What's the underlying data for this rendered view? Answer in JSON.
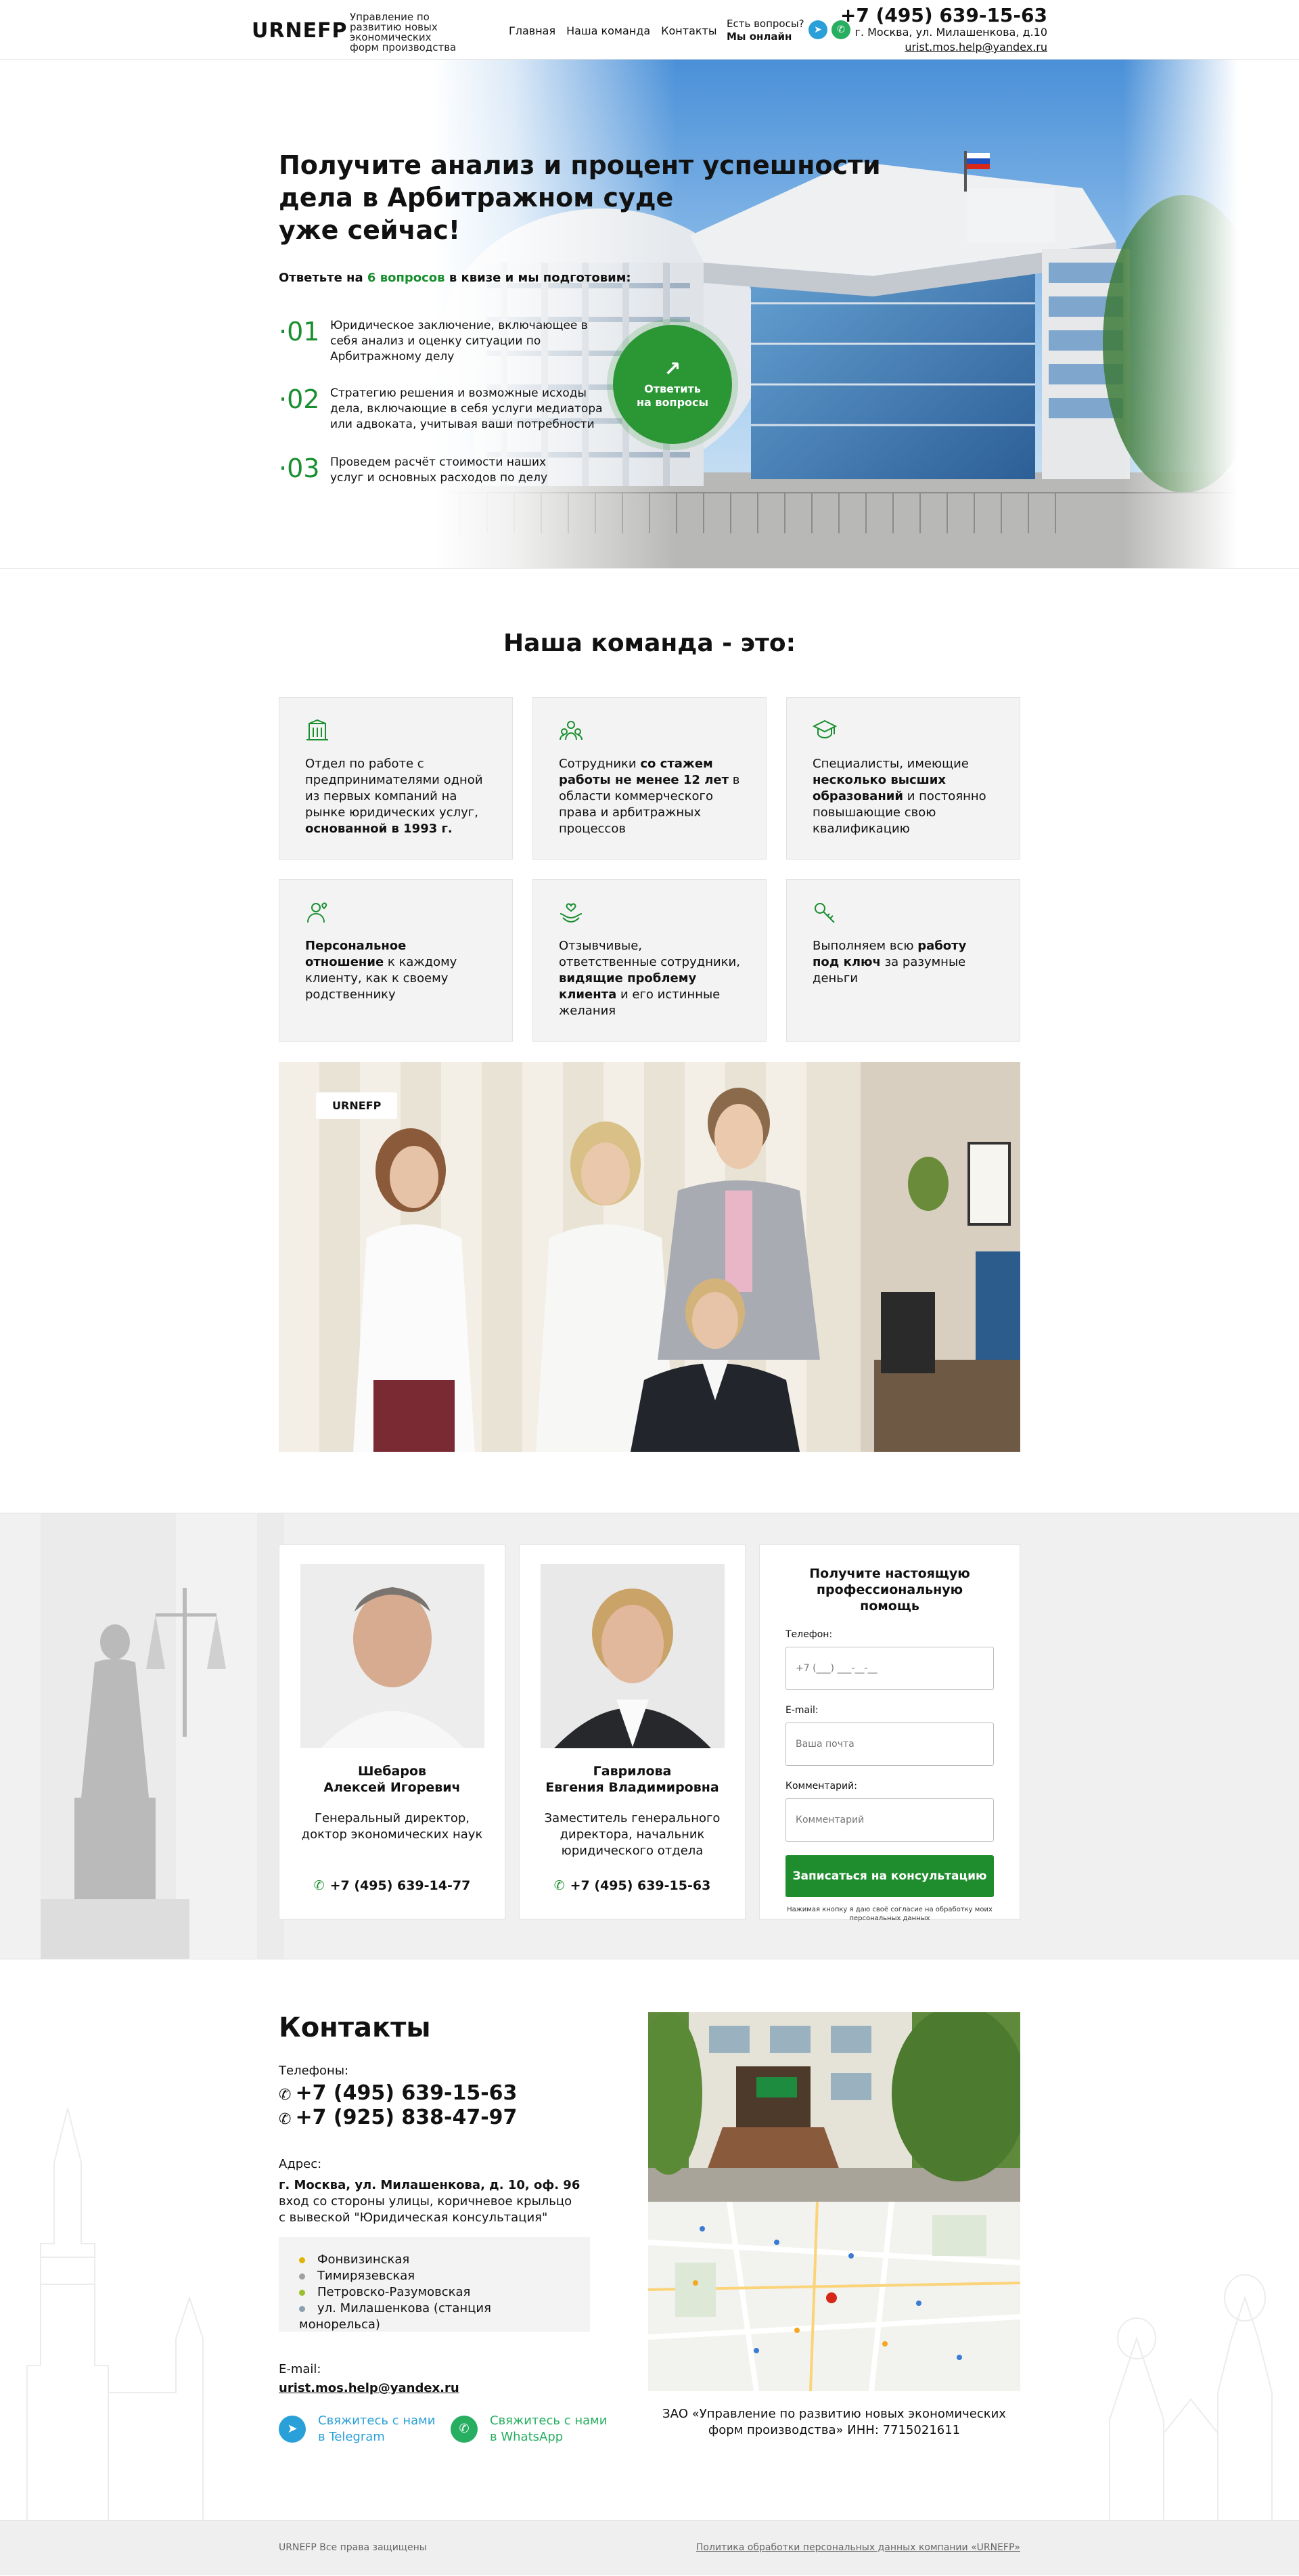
{
  "header": {
    "logo": "URNEFP",
    "logo_sub": "Управление по развитию новых экономических форм производства",
    "nav": [
      "Главная",
      "Наша команда",
      "Контакты"
    ],
    "question": "Есть вопросы?",
    "online": "Мы онлайн",
    "phone": "+7 (495) 639-15-63",
    "address": "г. Москва, ул. Милашенкова, д.10",
    "email": "urist.mos.help@yandex.ru"
  },
  "hero": {
    "title_line1": "Получите анализ и процент успешности",
    "title_line2": "дела в Арбитражном суде",
    "title_line3": "уже сейчас!",
    "sub_pre": "Ответьте на ",
    "sub_highlight": "6 вопросов",
    "sub_post": " в квизе и мы подготовим:",
    "steps": [
      {
        "num": "01",
        "text": "Юридическое заключение, включающее в себя анализ и оценку ситуации по Арбитражному делу"
      },
      {
        "num": "02",
        "text": "Стратегию решения и возможные исходы дела, включающие в себя услуги медиатора или адвоката, учитывая ваши потребности"
      },
      {
        "num": "03",
        "text": "Проведем расчёт стоимости наших услуг и основных расходов по делу"
      }
    ],
    "cta": "Ответить на вопросы"
  },
  "team": {
    "title": "Наша команда - это:",
    "cards": [
      {
        "icon": "building-icon",
        "a": "Отдел по работе с предпринимателями одной из первых компаний на рынке юридических услуг, ",
        "b": "основанной в 1993 г.",
        "c": ""
      },
      {
        "icon": "team-icon",
        "a": "Сотрудники ",
        "b": "со стажем работы не менее 12 лет",
        "c": " в области коммерческого права и арбитражных процессов"
      },
      {
        "icon": "graduate-icon",
        "a": "Специалисты, имеющие ",
        "b": "несколько высших образований",
        "c": " и постоянно повышающие свою квалификацию"
      },
      {
        "icon": "user-heart-icon",
        "a": "",
        "b": "Персональное отношение",
        "c": " к каждому клиенту, как к своему родственнику"
      },
      {
        "icon": "care-hands-icon",
        "a": "Отзывчивые, ответственные сотрудники, ",
        "b": "видящие проблему клиента",
        "c": " и его истинные желания"
      },
      {
        "icon": "key-icon",
        "a": "Выполняем всю ",
        "b": "работу под ключ",
        "c": " за разумные деньги"
      }
    ],
    "photo_badge": "URNEFP"
  },
  "consult": {
    "people": [
      {
        "name1": "Шебаров",
        "name2": "Алексей Игоревич",
        "role": "Генеральный директор, доктор экономических наук",
        "phone": "+7 (495) 639-14-77"
      },
      {
        "name1": "Гаврилова",
        "name2": "Евгения Владимировна",
        "role": "Заместитель генерального директора, начальник юридического отдела",
        "phone": "+7 (495) 639-15-63"
      }
    ],
    "form": {
      "title": "Получите настоящую профессиональную помощь",
      "phone_label": "Телефон:",
      "phone_ph": "+7 (___) ___-__-__",
      "email_label": "E-mail:",
      "email_ph": "Ваша почта",
      "comment_label": "Комментарий:",
      "comment_ph": "Комментарий",
      "submit": "Записаться на консультацию",
      "note": "Нажимая кнопку я даю своё согласие на обработку моих персональных данных"
    }
  },
  "contacts": {
    "title": "Контакты",
    "phones_label": "Телефоны:",
    "phone1": "+7 (495) 639-15-63",
    "phone2": "+7 (925) 838-47-97",
    "addr_label": "Адрес:",
    "addr_bold": "г. Москва, ул. Милашенкова, д. 10, оф. 96",
    "addr_line2": "вход со стороны улицы, коричневое крыльцо",
    "addr_line3": "с вывеской \"Юридическая консультация\"",
    "metro": [
      {
        "name": "Фонвизинская",
        "color": "#e0b300"
      },
      {
        "name": "Тимирязевская",
        "color": "#a0a0a0"
      },
      {
        "name": "Петровско-Разумовская",
        "color": "#9bbe2c"
      },
      {
        "name": "ул. Милашенкова (станция монорельса)",
        "color": "#8aa0b0"
      }
    ],
    "email_label": "E-mail:",
    "email": "urist.mos.help@yandex.ru",
    "tg_line1": "Свяжитесь с нами",
    "tg_line2": "в Telegram",
    "wa_line1": "Свяжитесь с нами",
    "wa_line2": "в WhatsApp",
    "org_line1": "ЗАО «Управление по развитию новых экономических",
    "org_line2": "форм производства»  ИНН: 7715021611"
  },
  "footer": {
    "rights": "URNEFP Все права защищены",
    "policy": "Политика обработки персональных данных компании «URNEFP»"
  },
  "colors": {
    "accent": "#1a8f2f",
    "telegram": "#2aa0d8",
    "whatsapp": "#27ae60"
  }
}
